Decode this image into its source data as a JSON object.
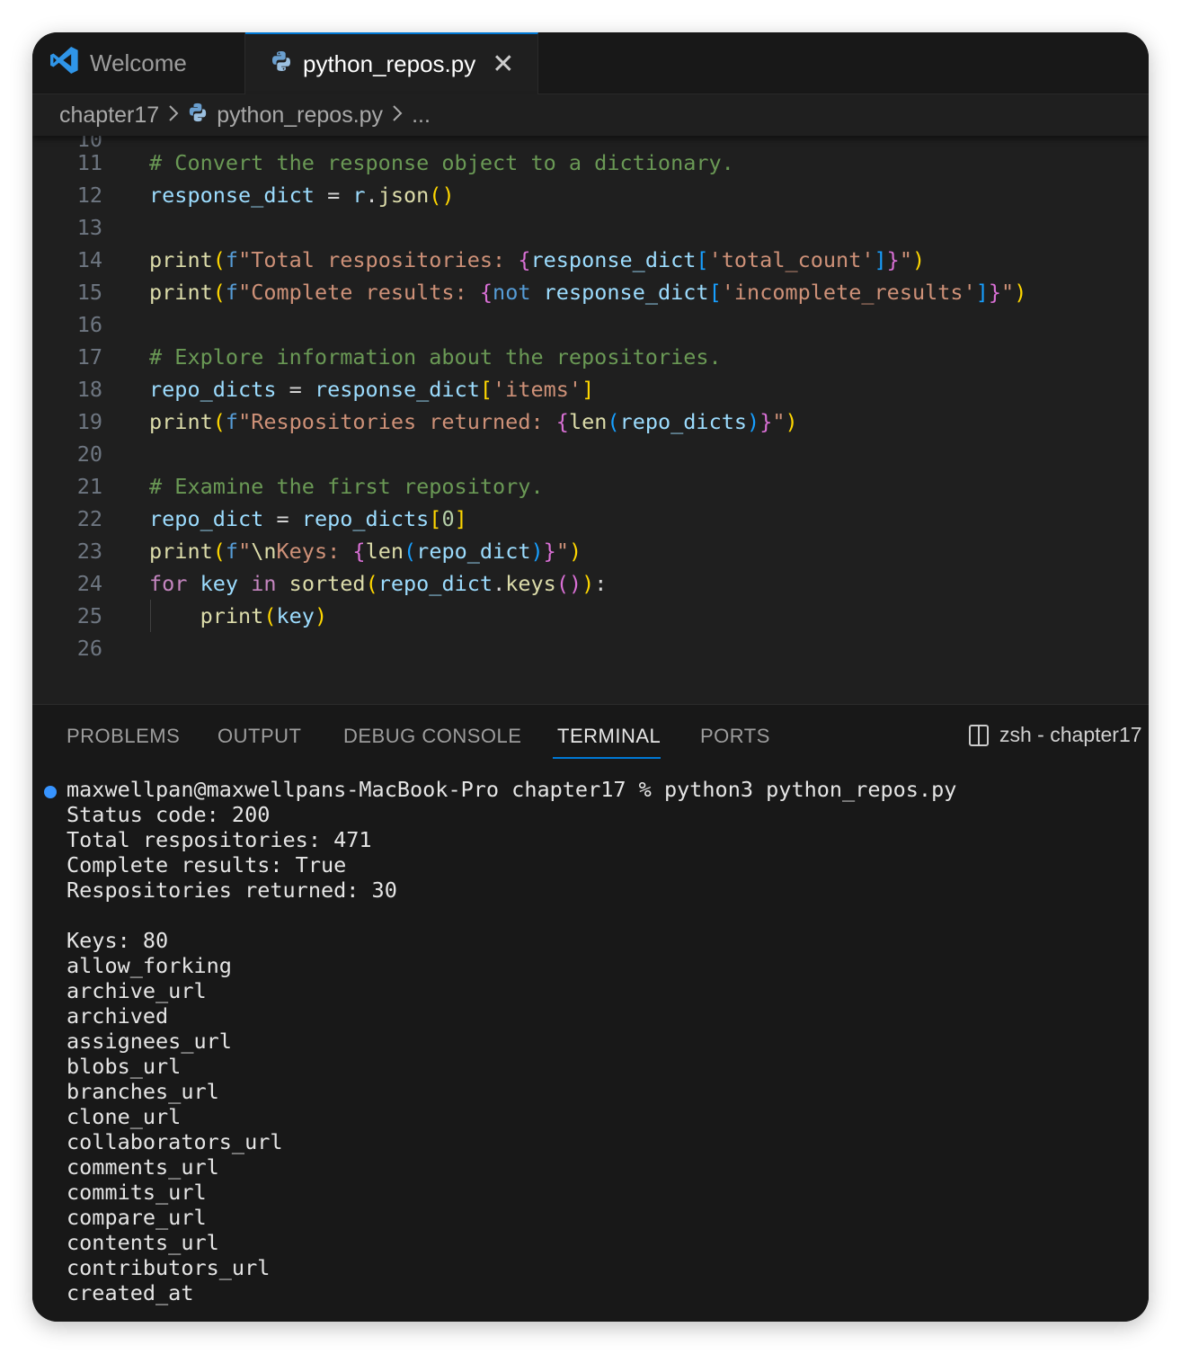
{
  "tabs": [
    {
      "label": "Welcome",
      "icon": "vscode-logo-icon",
      "active": false
    },
    {
      "label": "python_repos.py",
      "icon": "python-file-icon",
      "active": true,
      "close_glyph": "✕"
    }
  ],
  "breadcrumb": {
    "folder": "chapter17",
    "file": "python_repos.py",
    "more": "..."
  },
  "editor": {
    "partial_line_number": "10",
    "line_numbers": [
      "11",
      "12",
      "13",
      "14",
      "15",
      "16",
      "17",
      "18",
      "19",
      "20",
      "21",
      "22",
      "23",
      "24",
      "25",
      "26"
    ]
  },
  "panel": {
    "tabs": [
      "PROBLEMS",
      "OUTPUT",
      "DEBUG CONSOLE",
      "TERMINAL",
      "PORTS"
    ],
    "active_tab": "TERMINAL",
    "terminal_selector": "zsh - chapter17"
  },
  "terminal": {
    "prompt": "maxwellpan@maxwellpans-MacBook-Pro chapter17 % python3 python_repos.py",
    "output": [
      "Status code: 200",
      "Total respositories: 471",
      "Complete results: True",
      "Respositories returned: 30",
      "",
      "Keys: 80",
      "allow_forking",
      "archive_url",
      "archived",
      "assignees_url",
      "blobs_url",
      "branches_url",
      "clone_url",
      "collaborators_url",
      "comments_url",
      "commits_url",
      "compare_url",
      "contents_url",
      "contributors_url",
      "created_at"
    ]
  },
  "colors": {
    "accent": "#0078d4",
    "terminal_dot": "#3794ff",
    "comment": "#6a9955",
    "variable": "#9cdcfe",
    "function": "#dcdcaa",
    "string": "#ce9178"
  }
}
